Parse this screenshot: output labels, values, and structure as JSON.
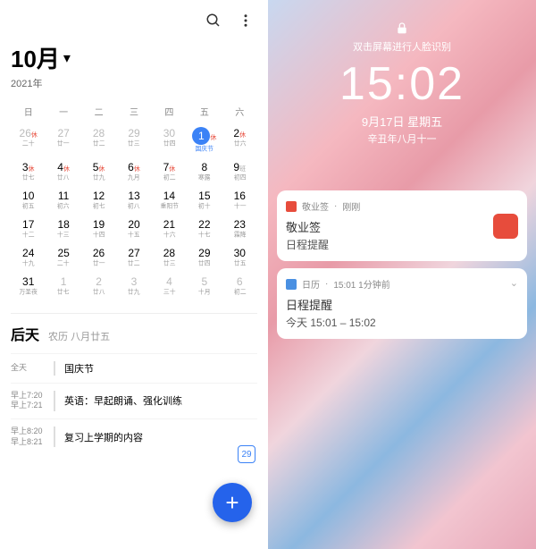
{
  "left": {
    "month": "10月",
    "year": "2021年",
    "weekdays": [
      "日",
      "一",
      "二",
      "三",
      "四",
      "五",
      "六"
    ],
    "weeks": [
      [
        {
          "n": "26",
          "l": "二十",
          "dim": 1,
          "s": "休"
        },
        {
          "n": "27",
          "l": "廿一",
          "dim": 1
        },
        {
          "n": "28",
          "l": "廿二",
          "dim": 1
        },
        {
          "n": "29",
          "l": "廿三",
          "dim": 1
        },
        {
          "n": "30",
          "l": "廿四",
          "dim": 1
        },
        {
          "n": "1",
          "l": "国庆节",
          "today": 1,
          "s": "休"
        },
        {
          "n": "2",
          "l": "廿六",
          "s": "休"
        }
      ],
      [
        {
          "n": "3",
          "l": "廿七",
          "s": "休"
        },
        {
          "n": "4",
          "l": "廿八",
          "s": "休"
        },
        {
          "n": "5",
          "l": "廿九",
          "s": "休"
        },
        {
          "n": "6",
          "l": "九月",
          "s": "休"
        },
        {
          "n": "7",
          "l": "初二",
          "s": "休"
        },
        {
          "n": "8",
          "l": "寒露"
        },
        {
          "n": "9",
          "l": "初四",
          "s": "班"
        }
      ],
      [
        {
          "n": "10",
          "l": "初五"
        },
        {
          "n": "11",
          "l": "初六"
        },
        {
          "n": "12",
          "l": "初七"
        },
        {
          "n": "13",
          "l": "初八"
        },
        {
          "n": "14",
          "l": "重阳节"
        },
        {
          "n": "15",
          "l": "初十"
        },
        {
          "n": "16",
          "l": "十一"
        }
      ],
      [
        {
          "n": "17",
          "l": "十二"
        },
        {
          "n": "18",
          "l": "十三"
        },
        {
          "n": "19",
          "l": "十四"
        },
        {
          "n": "20",
          "l": "十五"
        },
        {
          "n": "21",
          "l": "十六"
        },
        {
          "n": "22",
          "l": "十七"
        },
        {
          "n": "23",
          "l": "霜降"
        }
      ],
      [
        {
          "n": "24",
          "l": "十九"
        },
        {
          "n": "25",
          "l": "二十"
        },
        {
          "n": "26",
          "l": "廿一"
        },
        {
          "n": "27",
          "l": "廿二"
        },
        {
          "n": "28",
          "l": "廿三"
        },
        {
          "n": "29",
          "l": "廿四"
        },
        {
          "n": "30",
          "l": "廿五"
        }
      ],
      [
        {
          "n": "31",
          "l": "万圣夜"
        },
        {
          "n": "1",
          "l": "廿七",
          "dim": 1
        },
        {
          "n": "2",
          "l": "廿八",
          "dim": 1
        },
        {
          "n": "3",
          "l": "廿九",
          "dim": 1
        },
        {
          "n": "4",
          "l": "三十",
          "dim": 1
        },
        {
          "n": "5",
          "l": "十月",
          "dim": 1
        },
        {
          "n": "6",
          "l": "初二",
          "dim": 1
        }
      ]
    ],
    "agenda": {
      "title": "后天",
      "sub": "农历 八月廿五",
      "allday": "全天",
      "holiday": "国庆节",
      "events": [
        {
          "t1": "早上7:20",
          "t2": "早上7:21",
          "text": "英语：早起朗诵、强化训练"
        },
        {
          "t1": "早上8:20",
          "t2": "早上8:21",
          "text": "复习上学期的内容"
        }
      ]
    },
    "badge": "29"
  },
  "right": {
    "tip": "双击屏幕进行人脸识别",
    "time": "15:02",
    "date": "9月17日 星期五",
    "lunar": "辛丑年八月十一",
    "notifs": [
      {
        "app": "敬业签",
        "when": "刚刚",
        "title": "敬业签",
        "body": "日程提醒",
        "icon": "app"
      },
      {
        "app": "日历",
        "when": "15:01 1分钟前",
        "title": "日程提醒",
        "body": "今天 15:01 – 15:02",
        "icon": "cal",
        "chev": 1
      }
    ]
  }
}
